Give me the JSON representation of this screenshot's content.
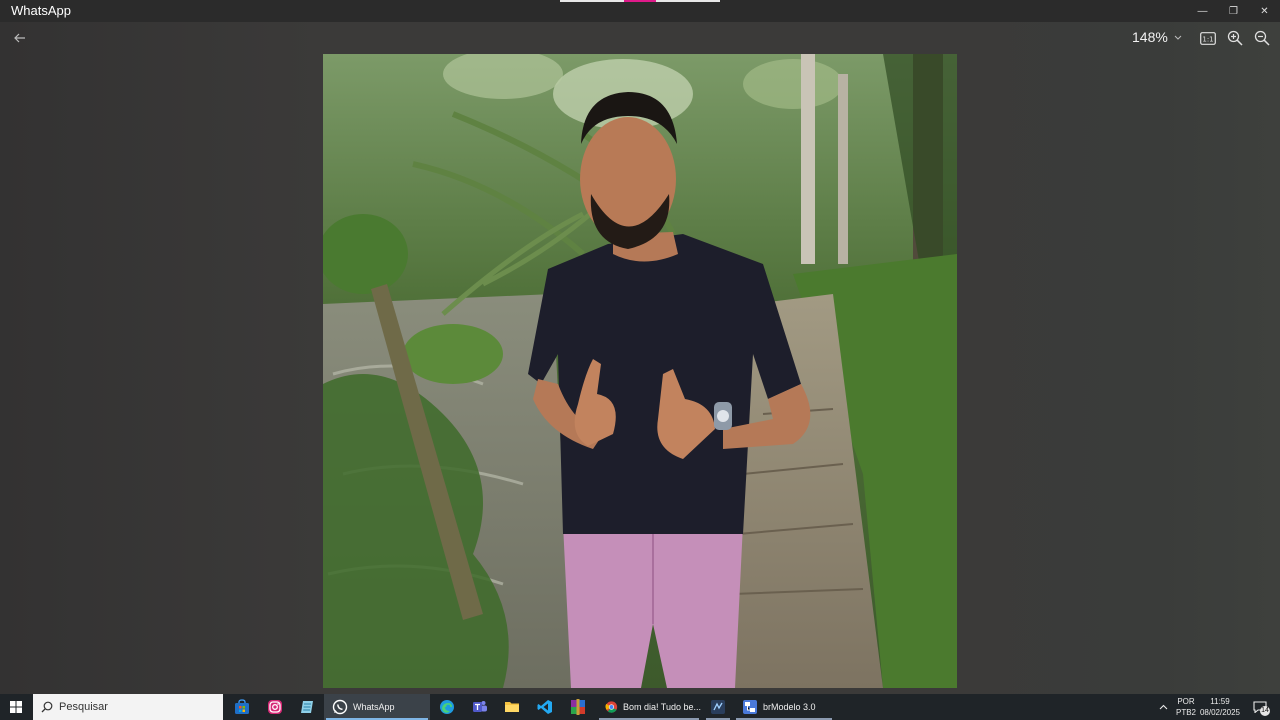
{
  "window": {
    "title": "WhatsApp",
    "controls": {
      "minimize": "—",
      "restore": "❐",
      "close": "✕"
    }
  },
  "viewer": {
    "zoom_level": "148%",
    "icons": [
      "back-arrow-icon",
      "chevron-down-icon",
      "actual-size-icon",
      "zoom-in-icon",
      "zoom-out-icon"
    ],
    "photo": {
      "subject": "Man with beard in dark t-shirt and pink shorts giving shaka hand signs on a stone path beside a stream in a tropical forest"
    }
  },
  "taskbar": {
    "search_placeholder": "Pesquisar",
    "apps": [
      {
        "icon": "store-icon"
      },
      {
        "icon": "instagram-icon"
      },
      {
        "icon": "notepad-icon"
      },
      {
        "icon": "whatsapp-icon",
        "label": "WhatsApp",
        "active": true
      },
      {
        "icon": "edge-icon"
      },
      {
        "icon": "teams-icon"
      },
      {
        "icon": "file-explorer-icon"
      },
      {
        "icon": "vscode-icon"
      },
      {
        "icon": "winrar-icon"
      },
      {
        "icon": "chrome-icon",
        "label": "Bom dia! Tudo be..."
      },
      {
        "icon": "terminal-app-icon"
      },
      {
        "icon": "brmodelo-icon",
        "label": "brModelo 3.0"
      }
    ],
    "tray": {
      "lang_line1": "POR",
      "lang_line2": "PTB2",
      "time": "11:59",
      "date": "08/02/2025",
      "notification_count": "14"
    }
  },
  "colors": {
    "accent_pink": "#e01a8a",
    "whatsapp_green": "#25d366",
    "taskbar_bg": "#1f2428"
  }
}
